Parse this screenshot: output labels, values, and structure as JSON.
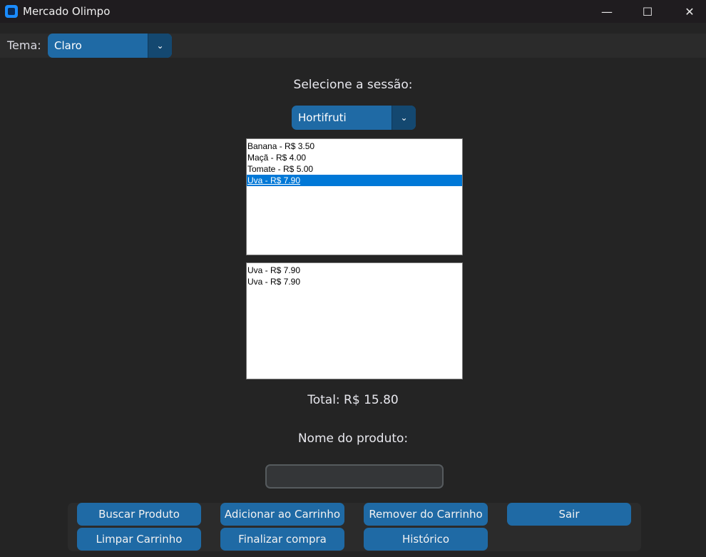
{
  "window": {
    "title": "Mercado Olimpo",
    "controls": {
      "minimize": "—",
      "maximize": "☐",
      "close": "✕"
    }
  },
  "theme": {
    "label": "Tema:",
    "selected": "Claro",
    "arrow": "⌄"
  },
  "session": {
    "heading": "Selecione a sessão:",
    "selected": "Hortifruti",
    "arrow": "⌄"
  },
  "products": {
    "items": [
      "Banana - R$ 3.50",
      "Maçã - R$ 4.00",
      "Tomate - R$ 5.00",
      "Uva - R$ 7.90"
    ],
    "selected_index": 3
  },
  "cart": {
    "items": [
      "Uva - R$ 7.90",
      "Uva - R$ 7.90"
    ]
  },
  "total": {
    "text": "Total: R$ 15.80"
  },
  "product_name": {
    "label": "Nome do produto:",
    "value": ""
  },
  "buttons": {
    "search": "Buscar Produto",
    "add": "Adicionar ao Carrinho",
    "remove": "Remover do Carrinho",
    "exit": "Sair",
    "clear": "Limpar Carrinho",
    "checkout": "Finalizar compra",
    "history": "Histórico"
  },
  "colors": {
    "background": "#242424",
    "accent": "#1f6aa5",
    "accent_dark": "#144870",
    "selection": "#0078d7"
  }
}
